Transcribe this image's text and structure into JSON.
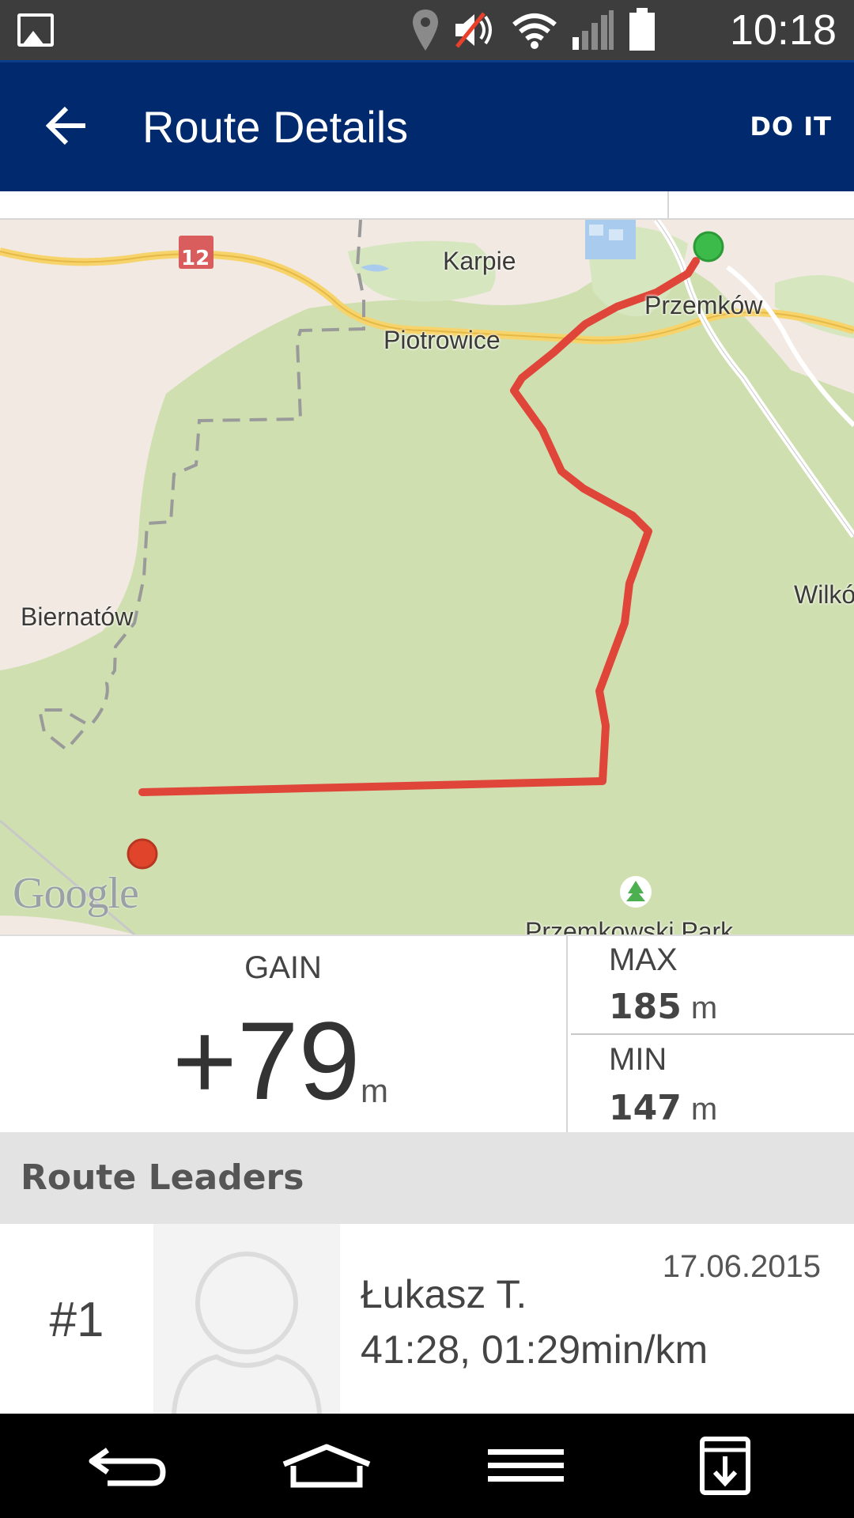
{
  "status_bar": {
    "time": "10:18",
    "icons": [
      "gallery-icon",
      "location-icon",
      "volume-muted-icon",
      "wifi-icon",
      "signal-icon",
      "battery-icon"
    ]
  },
  "app_bar": {
    "title": "Route Details",
    "action": "DO IT",
    "back_icon": "arrow-back-icon",
    "color": "#012a6e"
  },
  "map": {
    "places": {
      "karpie": "Karpie",
      "przemkow": "Przemków",
      "piotrowice": "Piotrowice",
      "biernatow": "Biernatów",
      "wilkow": "Wilkó",
      "park": "Przemkowski Park"
    },
    "road_number": "12",
    "attribution": "Google",
    "route_color": "#e0453a",
    "start_marker_color": "#3cba4a",
    "end_marker_color": "#e0452c"
  },
  "elevation": {
    "gain_label": "GAIN",
    "gain_value": "+79",
    "gain_unit": "m",
    "max_label": "MAX",
    "max_value": "185",
    "max_unit": "m",
    "min_label": "MIN",
    "min_value": "147",
    "min_unit": "m"
  },
  "leaders": {
    "header": "Route Leaders",
    "items": [
      {
        "rank": "#1",
        "name": "Łukasz T.",
        "result": "41:28, 01:29min/km",
        "date": "17.06.2015",
        "avatar_icon": "person-placeholder-icon"
      }
    ]
  },
  "nav_bar": {
    "icons": [
      "back-nav-icon",
      "home-nav-icon",
      "menu-nav-icon",
      "download-nav-icon"
    ]
  }
}
